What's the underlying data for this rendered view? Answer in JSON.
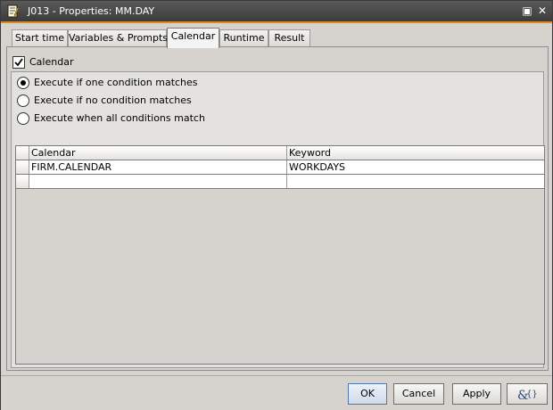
{
  "window": {
    "title": "J013 - Properties: MM.DAY",
    "title_icon": "properties-document-icon",
    "maximize_icon": "maximize-icon",
    "close_icon": "close-icon",
    "maximize_glyph": "▣",
    "close_glyph": "✕"
  },
  "tabs": [
    {
      "label": "Start time"
    },
    {
      "label": "Variables & Prompts"
    },
    {
      "label": "Calendar"
    },
    {
      "label": "Runtime"
    },
    {
      "label": "Result"
    }
  ],
  "active_tab": "Calendar",
  "calendar": {
    "enable_label": "Calendar",
    "enabled": true,
    "options": [
      {
        "label": "Execute if one condition matches",
        "selected": true
      },
      {
        "label": "Execute if no condition matches",
        "selected": false
      },
      {
        "label": "Execute when all conditions match",
        "selected": false
      }
    ]
  },
  "table": {
    "columns": [
      "Calendar",
      "Keyword"
    ],
    "rows": [
      [
        "FIRM.CALENDAR",
        "WORKDAYS"
      ],
      [
        "",
        ""
      ]
    ]
  },
  "buttons": {
    "ok": "OK",
    "cancel": "Cancel",
    "apply": "Apply",
    "script_icon": "script-variables-icon"
  },
  "colors": {
    "titlebar": "#3b3b3b",
    "title_accent": "#e08a1e",
    "dialog_bg": "#d6d3ce"
  }
}
